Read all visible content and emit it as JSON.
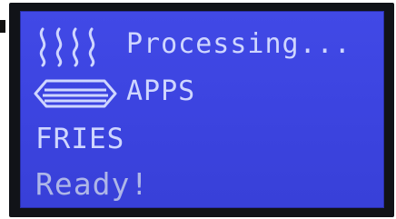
{
  "display": {
    "line1": "Processing...",
    "line2": "APPS",
    "line3": "FRIES",
    "line4": "Ready!"
  },
  "icons": {
    "line1_icon": "steam-icon",
    "line2_icon": "tray-icon"
  },
  "colors": {
    "screen_background": "#3c44e0",
    "text": "#cfd6ff",
    "bezel": "#111318"
  }
}
